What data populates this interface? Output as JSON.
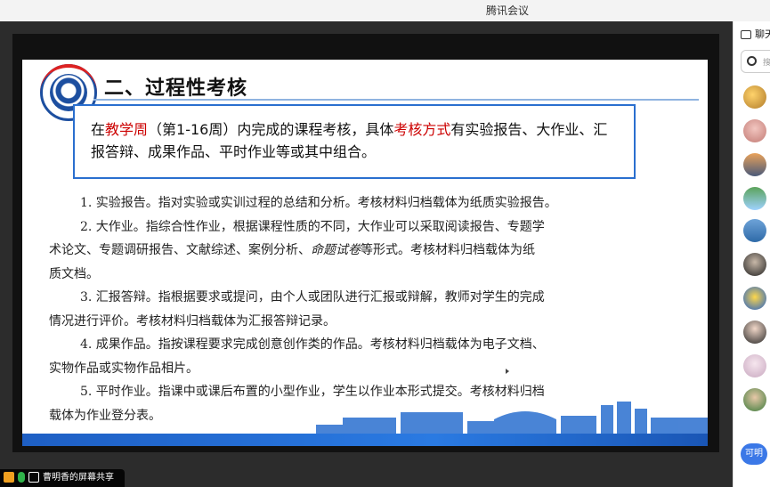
{
  "window": {
    "title": "腾讯会议"
  },
  "slide": {
    "title": "二、过程性考核",
    "callout": {
      "part1": "在",
      "red1": "教学周",
      "part2": "（第1-16周）内完成的课程考核，具体",
      "red2": "考核方式",
      "part3": "有实验报告、大作业、汇报答辩、成果作品、平时作业等或其中组合。"
    },
    "items": {
      "item1": "1. 实验报告。指对实验或实训过程的总结和分析。考核材料归档载体为纸质实验报告。",
      "item2a": "2. 大作业。指综合性作业，根据课程性质的不同，大作业可以采取阅读报告、专题学",
      "item2b": "术论文、专题调研报告、文献综述、案例分析、",
      "item2italic": "命题试卷",
      "item2c": "等形式。考核材料归档载体为纸",
      "item2d": "质文档。",
      "item3a": "3. 汇报答辩。指根据要求或提问，由个人或团队进行汇报或辩解，教师对学生的完成",
      "item3b": "情况进行评价。考核材料归档载体为汇报答辩记录。",
      "item4a": "4. 成果作品。指按课程要求完成创意创作类的作品。考核材料归档载体为电子文档、",
      "item4b": "实物作品或实物作品相片。",
      "item5a": "5. 平时作业。指课中或课后布置的小型作业，学生以作业本形式提交。考核材料归档",
      "item5b": "载体为作业登分表。"
    },
    "colors": {
      "accent_blue": "#2a6fcf",
      "highlight_red": "#c00000"
    }
  },
  "sidebar": {
    "chat_tab_label": "聊天",
    "search_placeholder": "搜",
    "more_button_label": "可明"
  },
  "share_bar": {
    "label": "曹明香的屏幕共享"
  }
}
